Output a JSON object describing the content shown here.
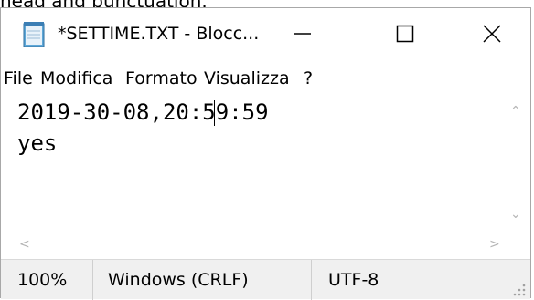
{
  "top_fragment": {
    "text": "nead and punctuation."
  },
  "window": {
    "title": "*SETTIME.TXT - Blocc...",
    "icon": "notepad-icon"
  },
  "controls": {
    "minimize_icon": "minimize-icon",
    "maximize_icon": "maximize-icon",
    "close_icon": "close-icon"
  },
  "menu": [
    "File",
    "Modifica",
    "Formato",
    "Visualizza",
    "?"
  ],
  "editor": {
    "lines": [
      "2019-30-08,20:59:59",
      "yes"
    ]
  },
  "statusbar": {
    "zoom": "100%",
    "line_ending": "Windows (CRLF)",
    "encoding": "UTF-8"
  },
  "colors": {
    "background": "#ffffff",
    "statusbar": "#f0f0f0",
    "scroll_arrow": "#b5b5b5"
  }
}
